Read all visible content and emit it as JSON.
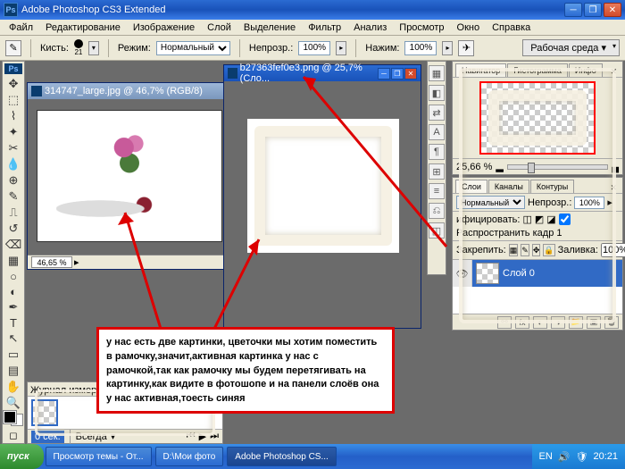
{
  "title": "Adobe Photoshop CS3 Extended",
  "menu": [
    "Файл",
    "Редактирование",
    "Изображение",
    "Слой",
    "Выделение",
    "Фильтр",
    "Анализ",
    "Просмотр",
    "Окно",
    "Справка"
  ],
  "opt": {
    "brush_label": "Кисть:",
    "brush_size": "21",
    "mode_label": "Режим:",
    "mode_value": "Нормальный",
    "opacity_label": "Непрозр.:",
    "opacity_value": "100%",
    "flow_label": "Нажим:",
    "flow_value": "100%",
    "workspace": "Рабочая среда ▾"
  },
  "tools": [
    "▯",
    "⬚",
    "✥",
    "✄",
    "✎",
    "✍",
    "⌗",
    "✦",
    "▭",
    "T",
    "➤",
    "✋",
    "🔍"
  ],
  "doc1": {
    "title": "314747_large.jpg @ 46,7% (RGB/8)",
    "zoom": "46,65 %"
  },
  "doc2": {
    "title": "b27363fef0e3.png @ 25,7% (Сло..."
  },
  "nav": {
    "tabs": [
      "Навигатор",
      "Гистограмма",
      "Инфо"
    ],
    "zoom": "25,66 %"
  },
  "layers": {
    "tabs": [
      "Слои",
      "Каналы",
      "Контуры"
    ],
    "blend": "Нормальный",
    "opacity_label": "Непрозр.:",
    "opacity": "100%",
    "unify_label": "ифицировать:",
    "propagate": "Распространить кадр 1",
    "lock_label": "Закрепить:",
    "fill_label": "Заливка:",
    "fill": "100%",
    "layer0": "Слой 0"
  },
  "history": {
    "tab": "Журнал измерений",
    "footer_always": "Всегда",
    "footer_time": "0 сек."
  },
  "annotation": "у нас есть две картинки, цветочки мы хотим поместить в рамочку,значит,активная картинка у нас с рамочкой,так как рамочку мы будем перетягивать на картинку,как видите в фотошопе и на панели слоёв она у нас активная,тоесть синяя",
  "taskbar": {
    "start": "пуск",
    "items": [
      "Просмотр темы - От...",
      "D:\\Мои фото",
      "Adobe Photoshop CS..."
    ],
    "lang": "EN",
    "time": "20:21"
  }
}
